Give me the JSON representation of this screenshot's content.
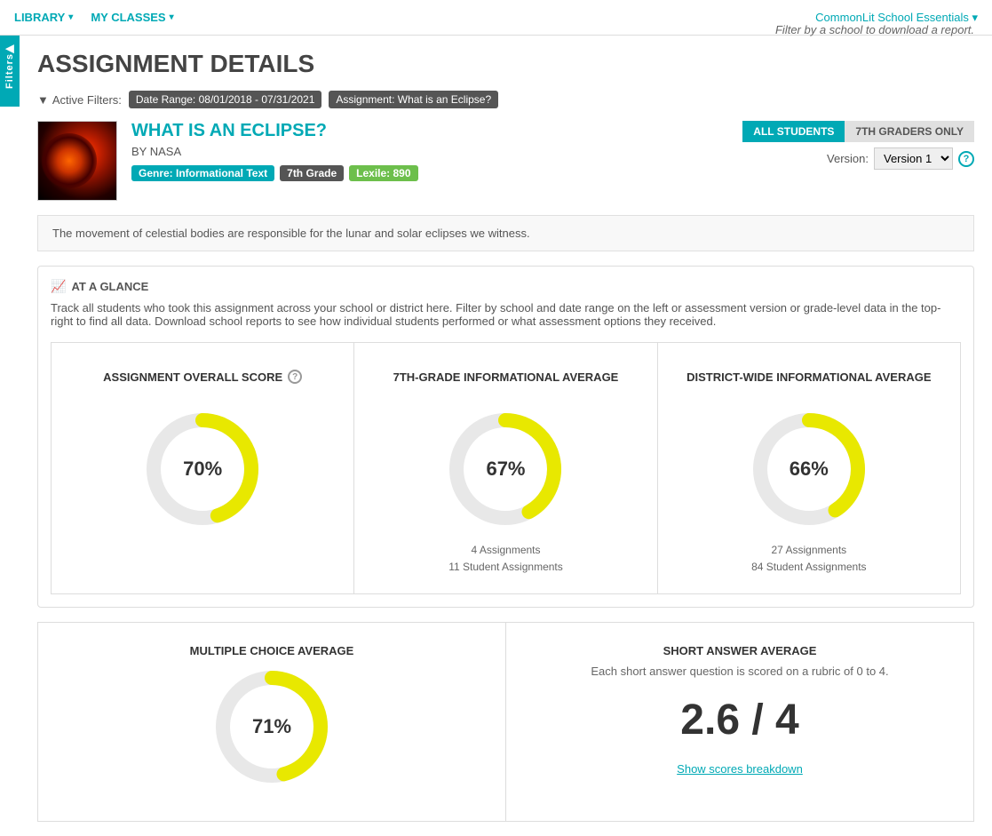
{
  "nav": {
    "library_label": "LIBRARY",
    "my_classes_label": "MY CLASSES",
    "top_right_label": "CommonLit School Essentials ▾"
  },
  "filters_panel": {
    "label": "Filters",
    "arrow": "▶"
  },
  "page": {
    "title": "ASSIGNMENT DETAILS",
    "filter_note": "Filter by a school to download a report."
  },
  "active_filters": {
    "label": "Active Filters:",
    "funnel_icon": "⛛",
    "filters": [
      {
        "text": "Date Range: 08/01/2018 - 07/31/2021"
      },
      {
        "text": "Assignment: What is an Eclipse?"
      }
    ]
  },
  "assignment": {
    "title": "WHAT IS AN ECLIPSE?",
    "author": "BY NASA",
    "tags": [
      {
        "label": "Genre: Informational Text",
        "type": "genre"
      },
      {
        "label": "7th Grade",
        "type": "grade"
      },
      {
        "label": "Lexile: 890",
        "type": "lexile"
      }
    ],
    "btn_all_students": "ALL STUDENTS",
    "btn_7th_graders": "7TH GRADERS ONLY",
    "version_label": "Version:",
    "version_value": "Version 1",
    "description": "The movement of celestial bodies are responsible for the lunar and solar eclipses we witness."
  },
  "glance": {
    "header": "AT A GLANCE",
    "description": "Track all students who took this assignment across your school or district here. Filter by school and date range on the left or assessment version or grade-level data in the top-right to find all data. Download school reports to see how individual students performed or what assessment options they received."
  },
  "score_cards": [
    {
      "title": "ASSIGNMENT OVERALL SCORE",
      "has_help": true,
      "percentage": 70,
      "label": "70%",
      "assignments_count": null,
      "student_assignments": null
    },
    {
      "title": "7TH-GRADE INFORMATIONAL AVERAGE",
      "has_help": false,
      "percentage": 67,
      "label": "67%",
      "assignments_count": "4 Assignments",
      "student_assignments": "11 Student Assignments"
    },
    {
      "title": "DISTRICT-WIDE INFORMATIONAL AVERAGE",
      "has_help": false,
      "percentage": 66,
      "label": "66%",
      "assignments_count": "27 Assignments",
      "student_assignments": "84 Student Assignments"
    }
  ],
  "bottom_cards": [
    {
      "id": "multiple-choice",
      "title": "MULTIPLE CHOICE AVERAGE",
      "type": "donut",
      "percentage": 71,
      "label": "71%"
    },
    {
      "id": "short-answer",
      "title": "SHORT ANSWER AVERAGE",
      "type": "text",
      "description": "Each short answer question is scored on a rubric of 0 to 4.",
      "score": "2.6 / 4",
      "link_label": "Show scores breakdown"
    }
  ],
  "colors": {
    "teal": "#00a9b5",
    "yellow": "#e8e800",
    "light_gray": "#e8e8e8"
  }
}
